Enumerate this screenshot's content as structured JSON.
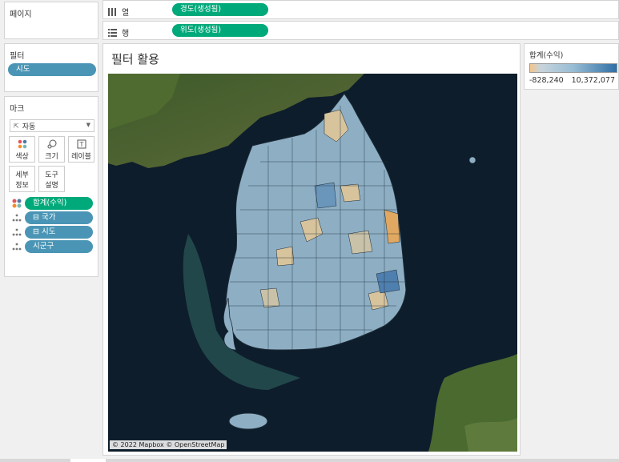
{
  "pages": {
    "title": "페이지"
  },
  "filters": {
    "title": "필터",
    "items": [
      {
        "label": "시도"
      }
    ]
  },
  "marks": {
    "title": "마크",
    "type_select": "자동",
    "buttons": {
      "color": "색상",
      "size": "크기",
      "label": "레이블",
      "detail_1": "세부",
      "detail_2": "정보",
      "tooltip_1": "도구",
      "tooltip_2": "설명"
    },
    "fields": [
      {
        "label": "합계(수익)",
        "kind": "color",
        "color": "#00a97a"
      },
      {
        "label": "⊟ 국가",
        "kind": "detail",
        "color": "#4a95b5"
      },
      {
        "label": "⊟ 시도",
        "kind": "detail",
        "color": "#4a95b5"
      },
      {
        "label": "시군구",
        "kind": "detail",
        "color": "#4a95b5"
      }
    ]
  },
  "columns_shelf": {
    "label": "열",
    "pill": "경도(생성됨)"
  },
  "rows_shelf": {
    "label": "행",
    "pill": "위도(생성됨)"
  },
  "view": {
    "title": "필터 활용",
    "attribution": "© 2022 Mapbox © OpenStreetMap"
  },
  "legend": {
    "title": "합계(수익)",
    "min": "-828,240",
    "max": "10,372,077",
    "low_color": "#f4c48a",
    "high_color": "#2f6fa5"
  },
  "colors": {
    "accent_green": "#00a97a",
    "pill_blue": "#4a95b5"
  }
}
